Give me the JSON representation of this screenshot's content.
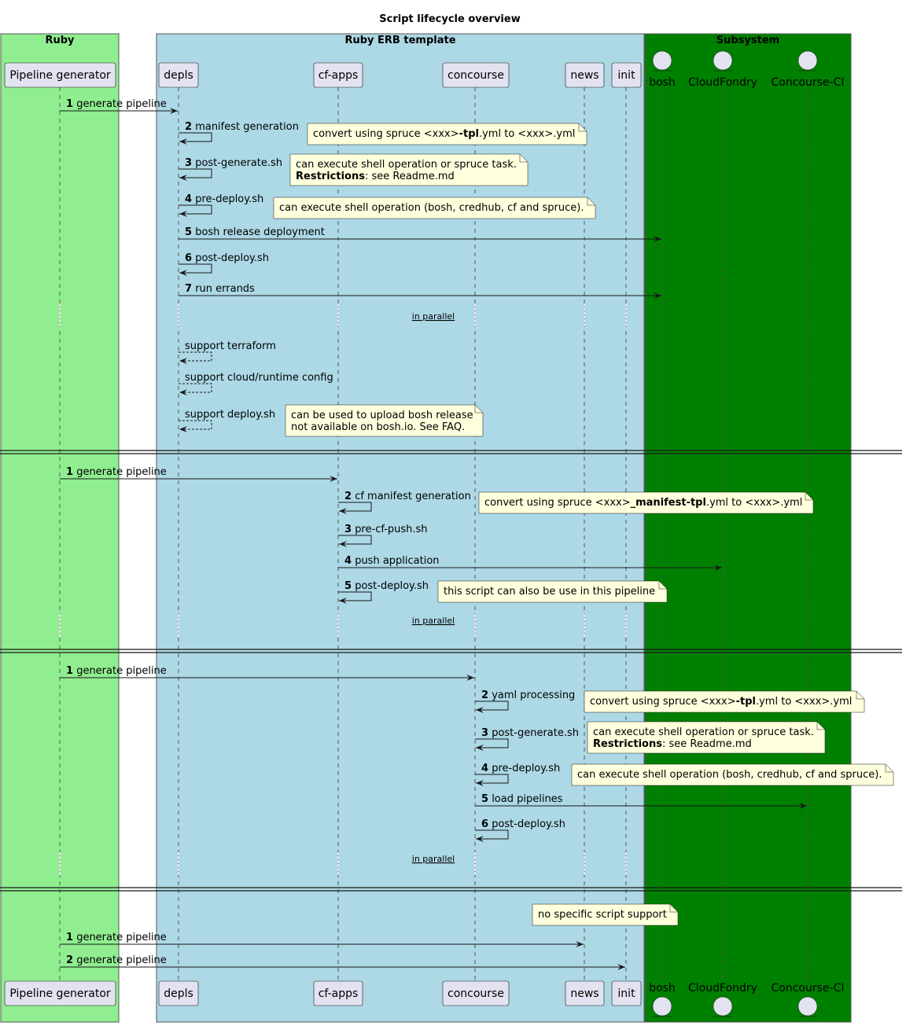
{
  "title": "Script lifecycle overview",
  "colors": {
    "ruby_box": "#90EE90",
    "erb_box": "#ADD8E6",
    "subsystem_box": "#008000",
    "participant_fill": "#E2E2F0",
    "note_fill": "#FEFFDD",
    "line": "#181818"
  },
  "boxes": [
    {
      "title": "Ruby"
    },
    {
      "title": "Ruby ERB template"
    },
    {
      "title": "Subsystem"
    }
  ],
  "participants": [
    {
      "id": "pg",
      "label": "Pipeline generator",
      "kind": "participant"
    },
    {
      "id": "depls",
      "label": "depls",
      "kind": "participant"
    },
    {
      "id": "cfapps",
      "label": "cf-apps",
      "kind": "participant"
    },
    {
      "id": "concourse",
      "label": "concourse",
      "kind": "participant"
    },
    {
      "id": "news",
      "label": "news",
      "kind": "participant"
    },
    {
      "id": "init",
      "label": "init",
      "kind": "participant"
    },
    {
      "id": "bosh",
      "label": "bosh",
      "kind": "entity"
    },
    {
      "id": "cf",
      "label": "CloudFondry",
      "kind": "entity"
    },
    {
      "id": "cci",
      "label": "Concourse-CI",
      "kind": "entity"
    }
  ],
  "sections": [
    {
      "messages": [
        {
          "num": "1",
          "text": "generate pipeline",
          "from": "pg",
          "to": "depls"
        },
        {
          "num": "2",
          "text": "manifest generation",
          "from": "depls",
          "to": "depls",
          "note": {
            "parts": [
              [
                "convert using spruce <xxx>",
                false
              ],
              [
                "-tpl",
                true
              ],
              [
                ".yml to <xxx>.yml",
                false
              ]
            ]
          }
        },
        {
          "num": "3",
          "text": "post-generate.sh",
          "from": "depls",
          "to": "depls",
          "note": {
            "lines": [
              [
                [
                  "can execute shell operation or spruce task.",
                  false
                ]
              ],
              [
                [
                  "Restrictions",
                  true
                ],
                [
                  ": see Readme.md",
                  false
                ]
              ]
            ]
          }
        },
        {
          "num": "4",
          "text": "pre-deploy.sh",
          "from": "depls",
          "to": "depls",
          "note": {
            "parts": [
              [
                "can execute shell operation (bosh, credhub, cf and spruce).",
                false
              ]
            ]
          }
        },
        {
          "num": "5",
          "text": "bosh release deployment",
          "from": "depls",
          "to": "bosh"
        },
        {
          "num": "6",
          "text": "post-deploy.sh",
          "from": "depls",
          "to": "depls"
        },
        {
          "num": "7",
          "text": "run errands",
          "from": "depls",
          "to": "bosh"
        }
      ],
      "divider": "in parallel",
      "optional": [
        {
          "text": "support terraform"
        },
        {
          "text": "support cloud/runtime config"
        },
        {
          "text": "support deploy.sh",
          "note": {
            "lines": [
              [
                [
                  "can be used to upload bosh release",
                  false
                ]
              ],
              [
                [
                  "not available on bosh.io. See FAQ.",
                  false
                ]
              ]
            ]
          }
        }
      ]
    },
    {
      "messages": [
        {
          "num": "1",
          "text": "generate pipeline",
          "from": "pg",
          "to": "cfapps"
        },
        {
          "num": "2",
          "text": "cf manifest generation",
          "from": "cfapps",
          "to": "cfapps",
          "note": {
            "parts": [
              [
                "convert using spruce <xxx>",
                false
              ],
              [
                "_manifest-tpl",
                true
              ],
              [
                ".yml to <xxx>.yml",
                false
              ]
            ]
          }
        },
        {
          "num": "3",
          "text": "pre-cf-push.sh",
          "from": "cfapps",
          "to": "cfapps"
        },
        {
          "num": "4",
          "text": "push application",
          "from": "cfapps",
          "to": "cf"
        },
        {
          "num": "5",
          "text": "post-deploy.sh",
          "from": "cfapps",
          "to": "cfapps",
          "note": {
            "parts": [
              [
                "this script can also be use in this pipeline",
                false
              ]
            ]
          }
        }
      ],
      "divider": "in parallel"
    },
    {
      "messages": [
        {
          "num": "1",
          "text": "generate pipeline",
          "from": "pg",
          "to": "concourse"
        },
        {
          "num": "2",
          "text": "yaml processing",
          "from": "concourse",
          "to": "concourse",
          "note": {
            "parts": [
              [
                "convert using spruce <xxx>",
                false
              ],
              [
                "-tpl",
                true
              ],
              [
                ".yml to <xxx>.yml",
                false
              ]
            ]
          }
        },
        {
          "num": "3",
          "text": "post-generate.sh",
          "from": "concourse",
          "to": "concourse",
          "note": {
            "lines": [
              [
                [
                  "can execute shell operation or spruce task.",
                  false
                ]
              ],
              [
                [
                  "Restrictions",
                  true
                ],
                [
                  ": see Readme.md",
                  false
                ]
              ]
            ]
          }
        },
        {
          "num": "4",
          "text": "pre-deploy.sh",
          "from": "concourse",
          "to": "concourse",
          "note": {
            "parts": [
              [
                "can execute shell operation (bosh, credhub, cf and spruce).",
                false
              ]
            ]
          }
        },
        {
          "num": "5",
          "text": "load pipelines",
          "from": "concourse",
          "to": "cci"
        },
        {
          "num": "6",
          "text": "post-deploy.sh",
          "from": "concourse",
          "to": "concourse"
        }
      ],
      "divider": "in parallel"
    },
    {
      "pre_note": {
        "parts": [
          [
            "no specific script support",
            false
          ]
        ]
      },
      "messages": [
        {
          "num": "1",
          "text": "generate pipeline",
          "from": "pg",
          "to": "news"
        },
        {
          "num": "2",
          "text": "generate pipeline",
          "from": "pg",
          "to": "init"
        }
      ]
    }
  ]
}
